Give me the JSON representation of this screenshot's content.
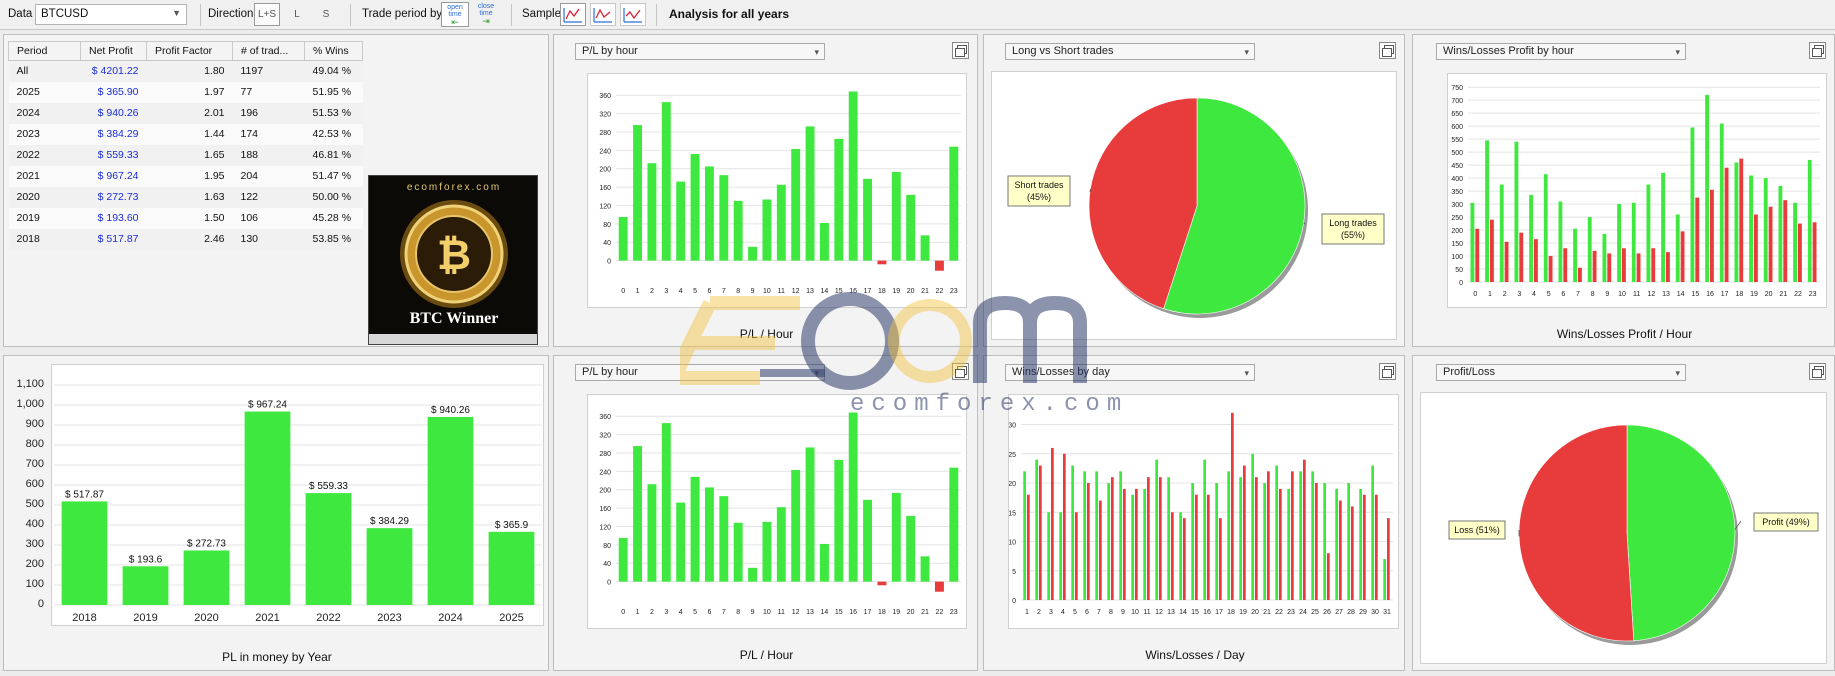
{
  "toolbar": {
    "data_label": "Data",
    "symbol": "BTCUSD",
    "direction_label": "Direction",
    "direction_options": [
      "L+S",
      "L",
      "S"
    ],
    "trade_period_label": "Trade period by",
    "period_open": "open time",
    "period_close": "close time",
    "sample_label": "Sample",
    "analysis_title": "Analysis for all years"
  },
  "stats_table": {
    "headers": [
      "Period",
      "Net Profit",
      "Profit Factor",
      "# of trad...",
      "% Wins"
    ],
    "rows": [
      [
        "All",
        "$ 4201.22",
        "1.80",
        "1197",
        "49.04 %"
      ],
      [
        "2025",
        "$ 365.90",
        "1.97",
        "77",
        "51.95 %"
      ],
      [
        "2024",
        "$ 940.26",
        "2.01",
        "196",
        "51.53 %"
      ],
      [
        "2023",
        "$ 384.29",
        "1.44",
        "174",
        "42.53 %"
      ],
      [
        "2022",
        "$ 559.33",
        "1.65",
        "188",
        "46.81 %"
      ],
      [
        "2021",
        "$ 967.24",
        "1.95",
        "204",
        "51.47 %"
      ],
      [
        "2020",
        "$ 272.73",
        "1.63",
        "122",
        "50.00 %"
      ],
      [
        "2019",
        "$ 193.60",
        "1.50",
        "106",
        "45.28 %"
      ],
      [
        "2018",
        "$ 517.87",
        "2.46",
        "130",
        "53.85 %"
      ]
    ]
  },
  "promo": {
    "site": "ecomforex.com",
    "title": "BTC Winner"
  },
  "watermark": {
    "text": "ecomforex.com"
  },
  "colors": {
    "profit": "#3ee83e",
    "loss": "#e83c3c",
    "link": "#1b2cd8"
  },
  "panels": {
    "plh_top_select": "P/L by hour",
    "ls_select": "Long vs Short trades",
    "wlh_select": "Wins/Losses Profit by hour",
    "plh_bottom_select": "P/L by hour",
    "wld_select": "Wins/Losses by day",
    "pl_select": "Profit/Loss"
  },
  "chart_data": [
    {
      "id": "pl_by_hour",
      "type": "bar",
      "xlabel": "P/L / Hour",
      "categories": [
        "0",
        "1",
        "2",
        "3",
        "4",
        "5",
        "6",
        "7",
        "8",
        "9",
        "10",
        "11",
        "12",
        "13",
        "14",
        "15",
        "16",
        "17",
        "18",
        "19",
        "20",
        "21",
        "22",
        "23"
      ],
      "values": [
        95,
        295,
        212,
        345,
        172,
        232,
        205,
        186,
        130,
        30,
        133,
        165,
        243,
        292,
        82,
        265,
        368,
        178,
        -8,
        193,
        143,
        55,
        -22,
        248
      ],
      "ylim": [
        -40,
        380
      ],
      "yticks": [
        0,
        40,
        80,
        120,
        160,
        200,
        240,
        280,
        320,
        360
      ]
    },
    {
      "id": "long_vs_short",
      "type": "pie",
      "slices": [
        {
          "label": "Long trades\n(55%)",
          "value": 55,
          "color": "#3ee83e"
        },
        {
          "label": "Short trades\n(45%)",
          "value": 45,
          "color": "#e83c3c"
        }
      ]
    },
    {
      "id": "wins_losses_profit_by_hour",
      "type": "bar",
      "xlabel": "Wins/Losses Profit / Hour",
      "categories": [
        "0",
        "1",
        "2",
        "3",
        "4",
        "5",
        "6",
        "7",
        "8",
        "9",
        "10",
        "11",
        "12",
        "13",
        "14",
        "15",
        "16",
        "17",
        "18",
        "19",
        "20",
        "21",
        "22",
        "23"
      ],
      "series": [
        {
          "values": [
            305,
            545,
            375,
            540,
            335,
            415,
            310,
            205,
            250,
            185,
            300,
            305,
            375,
            420,
            260,
            595,
            720,
            610,
            460,
            410,
            400,
            370,
            305,
            470
          ],
          "color": "#3ee83e"
        },
        {
          "values": [
            205,
            240,
            155,
            190,
            165,
            100,
            130,
            55,
            120,
            110,
            130,
            110,
            130,
            115,
            195,
            325,
            355,
            440,
            475,
            260,
            290,
            315,
            225,
            230
          ],
          "color": "#e83c3c"
        }
      ],
      "ylim": [
        0,
        770
      ],
      "yticks": [
        0,
        50,
        100,
        150,
        200,
        250,
        300,
        350,
        400,
        450,
        500,
        550,
        600,
        650,
        700,
        750
      ]
    },
    {
      "id": "pl_money_by_year",
      "type": "bar",
      "xlabel": "PL in money by Year",
      "categories": [
        "2018",
        "2019",
        "2020",
        "2021",
        "2022",
        "2023",
        "2024",
        "2025"
      ],
      "values": [
        517.87,
        193.6,
        272.73,
        967.24,
        559.33,
        384.29,
        940.26,
        365.9
      ],
      "value_labels": [
        "$ 517.87",
        "$ 193.6",
        "$ 272.73",
        "$ 967.24",
        "$ 559.33",
        "$ 384.29",
        "$ 940.26",
        "$ 365.9"
      ],
      "ylim": [
        0,
        1100
      ],
      "yticks": [
        0,
        100,
        200,
        300,
        400,
        500,
        600,
        700,
        800,
        900,
        1000,
        1100
      ]
    },
    {
      "id": "pl_by_hour_2",
      "type": "bar",
      "xlabel": "P/L / Hour",
      "categories": [
        "0",
        "1",
        "2",
        "3",
        "4",
        "5",
        "6",
        "7",
        "8",
        "9",
        "10",
        "11",
        "12",
        "13",
        "14",
        "15",
        "16",
        "17",
        "18",
        "19",
        "20",
        "21",
        "22",
        "23"
      ],
      "values": [
        95,
        295,
        212,
        345,
        172,
        228,
        205,
        186,
        128,
        30,
        130,
        162,
        243,
        292,
        82,
        265,
        368,
        178,
        -8,
        193,
        143,
        55,
        -22,
        248
      ],
      "ylim": [
        -40,
        380
      ],
      "yticks": [
        0,
        40,
        80,
        120,
        160,
        200,
        240,
        280,
        320,
        360
      ]
    },
    {
      "id": "wins_losses_by_day",
      "type": "bar",
      "xlabel": "Wins/Losses / Day",
      "categories": [
        "1",
        "2",
        "3",
        "4",
        "5",
        "6",
        "7",
        "8",
        "9",
        "10",
        "11",
        "12",
        "13",
        "14",
        "15",
        "16",
        "17",
        "18",
        "19",
        "20",
        "21",
        "22",
        "23",
        "24",
        "25",
        "26",
        "27",
        "28",
        "29",
        "30",
        "31"
      ],
      "series": [
        {
          "values": [
            22,
            24,
            15,
            15,
            23,
            22,
            22,
            20,
            22,
            18,
            19,
            24,
            21,
            15,
            20,
            24,
            20,
            22,
            21,
            25,
            20,
            23,
            19,
            22,
            22,
            20,
            19,
            20,
            19,
            23,
            7
          ],
          "color": "#3ee83e"
        },
        {
          "values": [
            18,
            23,
            26,
            25,
            15,
            20,
            17,
            21,
            19,
            19,
            21,
            21,
            15,
            14,
            18,
            18,
            14,
            32,
            23,
            21,
            22,
            19,
            22,
            24,
            20,
            8,
            17,
            16,
            18,
            18,
            14
          ],
          "color": "#e83c3c"
        }
      ],
      "ylim": [
        0,
        33
      ],
      "yticks": [
        0,
        5,
        10,
        15,
        20,
        25,
        30
      ]
    },
    {
      "id": "profit_loss",
      "type": "pie",
      "slices": [
        {
          "label": "Profit (49%)",
          "value": 49,
          "color": "#3ee83e"
        },
        {
          "label": "Loss (51%)",
          "value": 51,
          "color": "#e83c3c"
        }
      ]
    }
  ]
}
